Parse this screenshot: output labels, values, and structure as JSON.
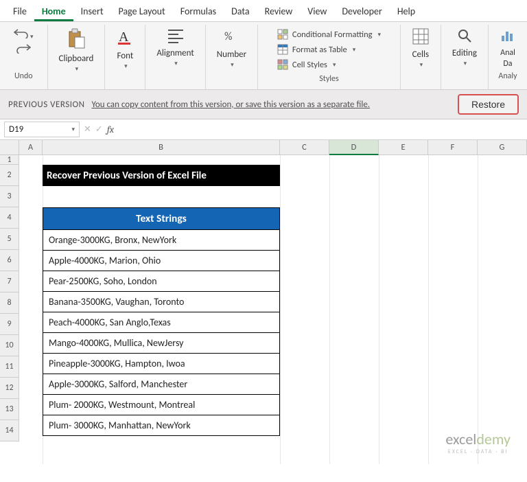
{
  "tabs": {
    "file": "File",
    "home": "Home",
    "insert": "Insert",
    "pagelayout": "Page Layout",
    "formulas": "Formulas",
    "data": "Data",
    "review": "Review",
    "view": "View",
    "developer": "Developer",
    "help": "Help"
  },
  "ribbon": {
    "undo_label": "Undo",
    "clipboard": {
      "big": "Clipboard",
      "drop": ""
    },
    "font": {
      "big": "Font",
      "drop": ""
    },
    "alignment": {
      "big": "Alignment",
      "drop": ""
    },
    "number": {
      "big": "Number",
      "drop": ""
    },
    "styles": {
      "label": "Styles",
      "cond": "Conditional Formatting",
      "fmt": "Format as Table",
      "cell": "Cell Styles"
    },
    "cells": {
      "big": "Cells",
      "drop": ""
    },
    "editing": {
      "big": "Editing",
      "drop": ""
    },
    "analysis": {
      "label": "Analy",
      "big": "Anal",
      "sub": "Da"
    }
  },
  "msgbar": {
    "label": "PREVIOUS VERSION",
    "link": "You can copy content from this version, or save this version as a separate file.",
    "restore": "Restore"
  },
  "namebox": "D19",
  "columns": [
    "A",
    "B",
    "C",
    "D",
    "E",
    "F",
    "G"
  ],
  "rows": [
    "1",
    "2",
    "3",
    "4",
    "5",
    "6",
    "7",
    "8",
    "9",
    "10",
    "11",
    "12",
    "13",
    "14"
  ],
  "title": "Recover Previous Version of Excel File",
  "table_header": "Text Strings",
  "table_data": [
    "Orange-3000KG, Bronx, NewYork",
    "Apple-4000KG, Marion, Ohio",
    "Pear-2500KG, Soho, London",
    "Banana-3500KG, Vaughan, Toronto",
    "Peach-4000KG, San Anglo,Texas",
    "Mango-4000KG, Mullica, NewJersy",
    "Pineapple-3000KG, Hampton, Iwoa",
    "Apple-3000KG, Salford, Manchester",
    "Plum- 2000KG, Westmount, Montreal",
    "Plum- 3000KG, Manhattan, NewYork"
  ],
  "watermark": {
    "brand1": "excel",
    "brand2": "demy",
    "tag": "EXCEL · DATA · BI"
  }
}
